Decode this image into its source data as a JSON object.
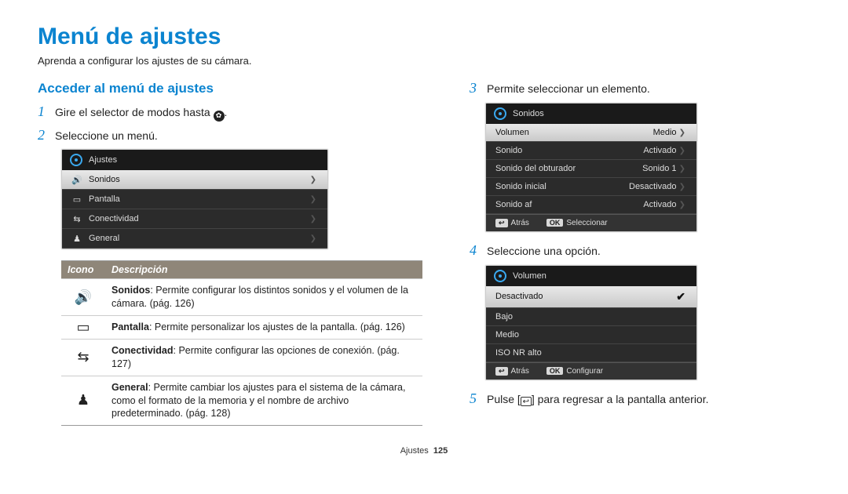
{
  "title": "Menú de ajustes",
  "intro": "Aprenda a configurar los ajustes de su cámara.",
  "left": {
    "heading": "Acceder al menú de ajustes",
    "steps": {
      "s1_pre": "Gire el selector de modos hasta ",
      "s1_post": ".",
      "s2": "Seleccione un menú."
    },
    "panel1": {
      "title": "Ajustes",
      "items": [
        {
          "label": "Sonidos"
        },
        {
          "label": "Pantalla"
        },
        {
          "label": "Conectividad"
        },
        {
          "label": "General"
        }
      ]
    },
    "table": {
      "h1": "Icono",
      "h2": "Descripción",
      "rows": [
        {
          "title": "Sonidos",
          "text": ": Permite configurar los distintos sonidos y el volumen de la cámara. (pág. 126)"
        },
        {
          "title": "Pantalla",
          "text": ": Permite personalizar los ajustes de la pantalla. (pág. 126)"
        },
        {
          "title": "Conectividad",
          "text": ": Permite configurar las opciones de conexión. (pág. 127)"
        },
        {
          "title": "General",
          "text": ": Permite cambiar los ajustes para el sistema de la cámara, como el formato de la memoria y el nombre de archivo predeterminado. (pág. 128)"
        }
      ]
    }
  },
  "right": {
    "s3": "Permite seleccionar un elemento.",
    "panel2": {
      "title": "Sonidos",
      "rows": [
        {
          "label": "Volumen",
          "value": "Medio"
        },
        {
          "label": "Sonido",
          "value": "Activado"
        },
        {
          "label": "Sonido del obturador",
          "value": "Sonido 1"
        },
        {
          "label": "Sonido inicial",
          "value": "Desactivado"
        },
        {
          "label": "Sonido af",
          "value": "Activado"
        }
      ],
      "back": "Atrás",
      "action": "Seleccionar",
      "back_btn": "↩",
      "ok_btn": "OK"
    },
    "s4": "Seleccione una opción.",
    "panel3": {
      "title": "Volumen",
      "rows": [
        {
          "label": "Desactivado",
          "sel": true
        },
        {
          "label": "Bajo"
        },
        {
          "label": "Medio"
        },
        {
          "label": "ISO NR alto"
        }
      ],
      "back": "Atrás",
      "action": "Configurar",
      "back_btn": "↩",
      "ok_btn": "OK"
    },
    "s5_pre": "Pulse [",
    "s5_post": "] para regresar a la pantalla anterior."
  },
  "footer": {
    "section": "Ajustes",
    "page": "125"
  }
}
